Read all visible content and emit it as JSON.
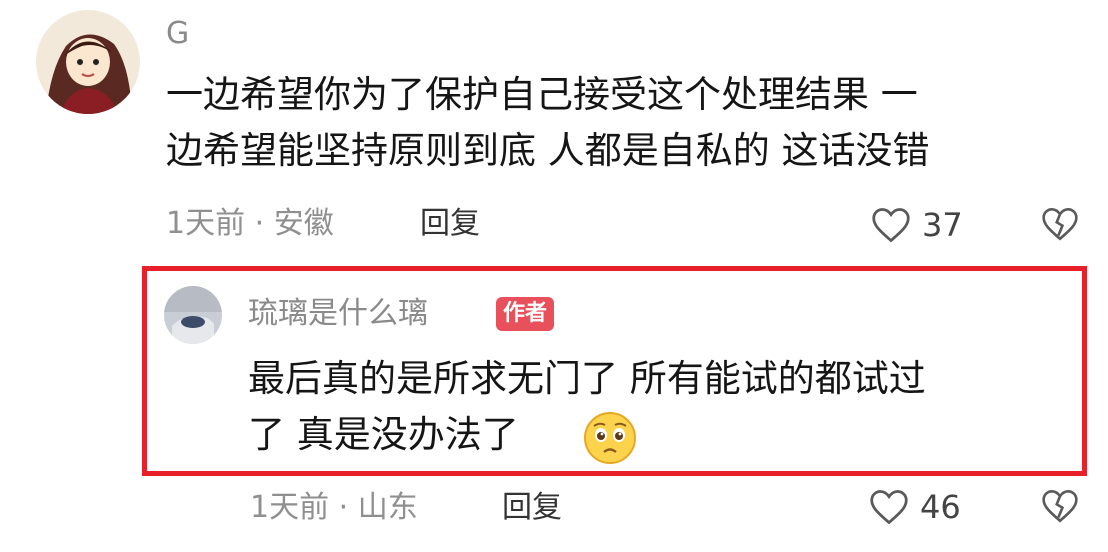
{
  "comments": [
    {
      "username": "G",
      "text_line1": "一边希望你为了保护自己接受这个处理结果 一",
      "text_line2": "边希望能坚持原则到底 人都是自私的 这话没错",
      "meta": "1天前 · 安徽",
      "reply_label": "回复",
      "likes": "37",
      "avatar_icon": "anime-girl-avatar-icon"
    },
    {
      "username": "琉璃是什么璃",
      "badge": "作者",
      "text_line1": "最后真的是所求无门了  所有能试的都试过",
      "text_line2": "了  真是没办法了",
      "emoji": "pleading-face-emoji",
      "meta": "1天前 · 山东",
      "reply_label": "回复",
      "likes": "46",
      "highlight_color": "#e8202a"
    }
  ]
}
